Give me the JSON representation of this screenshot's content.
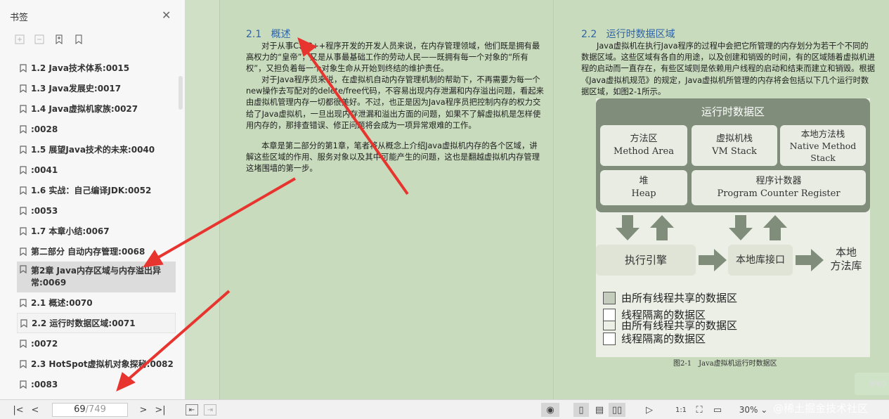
{
  "sidebar": {
    "title": "书签",
    "bookmarks": [
      {
        "label": "1.2 Java技术体系:0015"
      },
      {
        "label": "1.3 Java发展史:0017"
      },
      {
        "label": "1.4 Java虚拟机家族:0027"
      },
      {
        "label": ":0028"
      },
      {
        "label": "1.5 展望Java技术的未来:0040"
      },
      {
        "label": ":0041"
      },
      {
        "label": "1.6 实战：自己编译JDK:0052"
      },
      {
        "label": ":0053"
      },
      {
        "label": "1.7 本章小结:0067"
      },
      {
        "label": "第二部分 自动内存管理:0068"
      },
      {
        "label": "第2章 Java内存区域与内存溢出异常:0069"
      },
      {
        "label": "2.1 概述:0070"
      },
      {
        "label": "2.2 运行时数据区域:0071"
      },
      {
        "label": ":0072"
      },
      {
        "label": "2.3 HotSpot虚拟机对象探秘:0082"
      },
      {
        "label": ":0083"
      }
    ]
  },
  "left_page": {
    "heading_num": "2.1",
    "heading": "概述",
    "paragraphs": [
      "对于从事C、C++程序开发的开发人员来说，在内存管理领域，他们既是拥有最高权力的“皇帝”，又是从事最基础工作的劳动人民——既拥有每一个对象的“所有权”，又担负着每一个对象生命从开始到终结的维护责任。",
      "对于Java程序员来说，在虚拟机自动内存管理机制的帮助下，不再需要为每一个new操作去写配对的delete/free代码，不容易出现内存泄漏和内存溢出问题，看起来由虚拟机管理内存一切都很美好。不过，也正是因为Java程序员把控制内存的权力交给了Java虚拟机，一旦出现内存泄漏和溢出方面的问题，如果不了解虚拟机是怎样使用内存的，那排查错误、修正问题将会成为一项异常艰难的工作。",
      "本章是第二部分的第1章，笔者将从概念上介绍Java虚拟机内存的各个区域，讲解这些区域的作用、服务对象以及其中可能产生的问题，这也是翻越虚拟机内存管理这堵围墙的第一步。"
    ]
  },
  "right_page": {
    "heading_num": "2.2",
    "heading": "运行时数据区域",
    "paragraph": "Java虚拟机在执行Java程序的过程中会把它所管理的内存划分为若干个不同的数据区域。这些区域有各自的用途，以及创建和销毁的时间，有的区域随着虚拟机进程的启动而一直存在，有些区域则是依赖用户线程的启动和结束而建立和销毁。根据《Java虚拟机规范》的规定，Java虚拟机所管理的内存将会包括以下几个运行时数据区域，如图2-1所示。",
    "figure": {
      "title": "运行时数据区",
      "method_area": [
        "方法区",
        "Method Area"
      ],
      "vm_stack": [
        "虚拟机栈",
        "VM Stack"
      ],
      "native_stack": [
        "本地方法栈",
        "Native Method",
        "Stack"
      ],
      "heap": [
        "堆",
        "Heap"
      ],
      "pc": [
        "程序计数器",
        "Program Counter Register"
      ],
      "engine": "执行引擎",
      "native_interface": "本地库接口",
      "native_lib": [
        "本地",
        "方法库"
      ],
      "legend_shared": "由所有线程共享的数据区",
      "legend_isolated": "线程隔离的数据区",
      "legend_ghost": "由所有线程共享的数据区",
      "legend_isolated2": "线程隔离的数据区",
      "caption": "图2-1　Java虚拟机运行时数据区"
    }
  },
  "page_badge": "第69",
  "bottombar": {
    "current_page": "69",
    "total_pages": "/749",
    "zoom": "30%"
  },
  "watermark": "@稀土掘金技术社区",
  "colors": {
    "doc_bg": "#cfe0c6",
    "heading_blue": "#2f63a5",
    "arrow_red": "#e8342e",
    "diagram_dark": "#7f8d7a"
  }
}
